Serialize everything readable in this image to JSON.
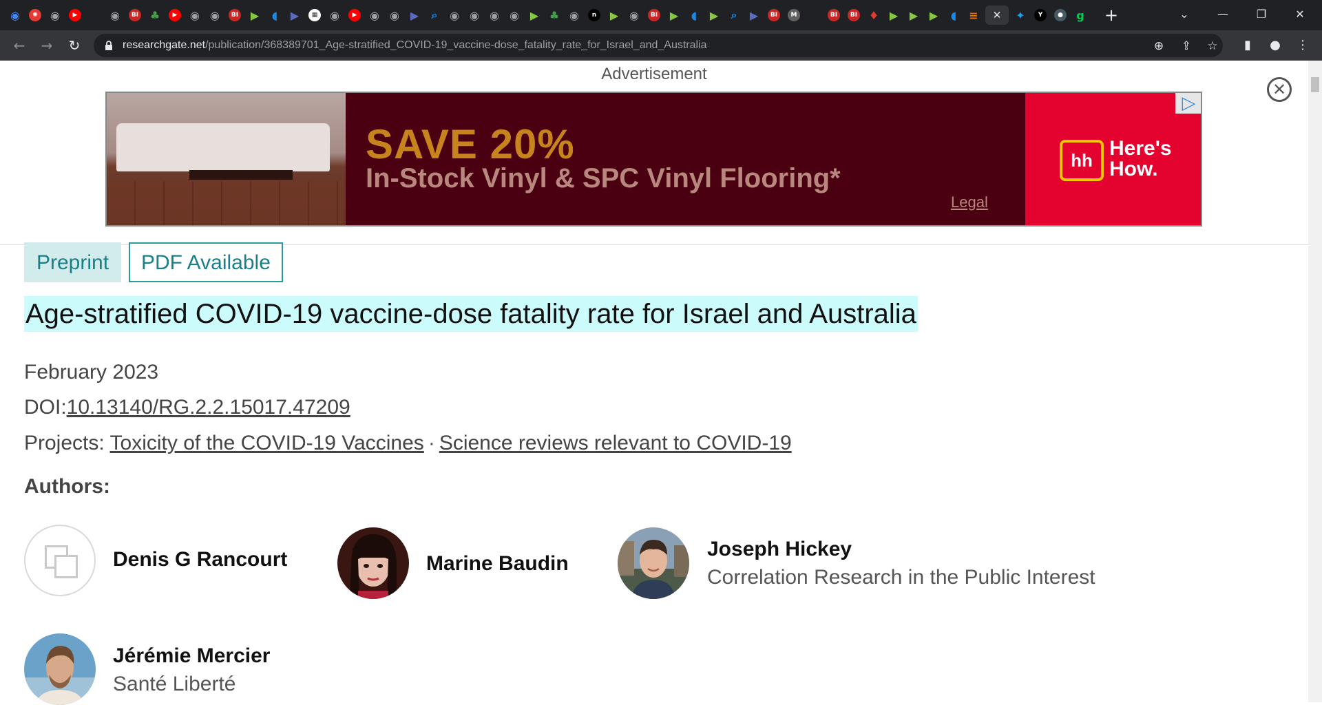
{
  "browser": {
    "url_host": "researchgate.net",
    "url_path": "/publication/368389701_Age-stratified_COVID-19_vaccine-dose_fatality_rate_for_Israel_and_Australia",
    "new_tab_label": "+",
    "tabs": [
      {
        "icon": "globe-icon",
        "color": "#4285f4",
        "glyph": "◉"
      },
      {
        "icon": "soccer-icon",
        "color": "#e53935",
        "glyph": "✺"
      },
      {
        "icon": "globe-icon",
        "color": "#9aa0a6",
        "glyph": "◉"
      },
      {
        "icon": "youtube-icon",
        "color": "#ff0000",
        "glyph": "▶"
      },
      {
        "icon": "blank-icon",
        "color": "#202124",
        "glyph": ""
      },
      {
        "icon": "globe-icon",
        "color": "#9aa0a6",
        "glyph": "◉"
      },
      {
        "icon": "bi-icon",
        "color": "#c62828",
        "glyph": "BI"
      },
      {
        "icon": "tree-icon",
        "color": "#43a047",
        "glyph": "♣"
      },
      {
        "icon": "youtube-icon",
        "color": "#ff0000",
        "glyph": "▶"
      },
      {
        "icon": "globe-icon",
        "color": "#9aa0a6",
        "glyph": "◉"
      },
      {
        "icon": "globe-icon",
        "color": "#9aa0a6",
        "glyph": "◉"
      },
      {
        "icon": "bi-icon",
        "color": "#c62828",
        "glyph": "BI"
      },
      {
        "icon": "rumble-icon",
        "color": "#85c742",
        "glyph": "▶"
      },
      {
        "icon": "shield-icon",
        "color": "#1e88e5",
        "glyph": "◖"
      },
      {
        "icon": "flag-icon",
        "color": "#5c6bc0",
        "glyph": "▶"
      },
      {
        "icon": "qr-icon",
        "color": "#ffffff",
        "glyph": "▦"
      },
      {
        "icon": "globe-icon",
        "color": "#9aa0a6",
        "glyph": "◉"
      },
      {
        "icon": "youtube-icon",
        "color": "#ff0000",
        "glyph": "▶"
      },
      {
        "icon": "globe-icon",
        "color": "#9aa0a6",
        "glyph": "◉"
      },
      {
        "icon": "globe-icon",
        "color": "#9aa0a6",
        "glyph": "◉"
      },
      {
        "icon": "flag-icon",
        "color": "#5c6bc0",
        "glyph": "▶"
      },
      {
        "icon": "search-icon",
        "color": "#1e88e5",
        "glyph": "⌕"
      },
      {
        "icon": "globe-icon",
        "color": "#9aa0a6",
        "glyph": "◉"
      },
      {
        "icon": "globe-icon",
        "color": "#9aa0a6",
        "glyph": "◉"
      },
      {
        "icon": "globe-icon",
        "color": "#9aa0a6",
        "glyph": "◉"
      },
      {
        "icon": "globe-icon",
        "color": "#9aa0a6",
        "glyph": "◉"
      },
      {
        "icon": "rumble-icon",
        "color": "#85c742",
        "glyph": "▶"
      },
      {
        "icon": "tree-icon",
        "color": "#43a047",
        "glyph": "♣"
      },
      {
        "icon": "globe-icon",
        "color": "#9aa0a6",
        "glyph": "◉"
      },
      {
        "icon": "n-icon",
        "color": "#000000",
        "glyph": "n"
      },
      {
        "icon": "rumble-icon",
        "color": "#85c742",
        "glyph": "▶"
      },
      {
        "icon": "globe-icon",
        "color": "#9aa0a6",
        "glyph": "◉"
      },
      {
        "icon": "bi-icon",
        "color": "#c62828",
        "glyph": "BI"
      },
      {
        "icon": "rumble-icon",
        "color": "#85c742",
        "glyph": "▶"
      },
      {
        "icon": "shield-icon",
        "color": "#1e88e5",
        "glyph": "◖"
      },
      {
        "icon": "rumble-icon",
        "color": "#85c742",
        "glyph": "▶"
      },
      {
        "icon": "search-icon",
        "color": "#1e88e5",
        "glyph": "⌕"
      },
      {
        "icon": "flag-icon",
        "color": "#5c6bc0",
        "glyph": "▶"
      },
      {
        "icon": "bi-icon",
        "color": "#c62828",
        "glyph": "BI"
      },
      {
        "icon": "italic-icon",
        "color": "#616161",
        "glyph": "M"
      },
      {
        "icon": "blank-icon",
        "color": "#202124",
        "glyph": ""
      },
      {
        "icon": "bi-icon",
        "color": "#c62828",
        "glyph": "BI"
      },
      {
        "icon": "bi-icon",
        "color": "#c62828",
        "glyph": "BI"
      },
      {
        "icon": "pin-icon",
        "color": "#e53935",
        "glyph": "♦"
      },
      {
        "icon": "rumble-icon",
        "color": "#85c742",
        "glyph": "▶"
      },
      {
        "icon": "rumble-icon",
        "color": "#85c742",
        "glyph": "▶"
      },
      {
        "icon": "rumble-icon",
        "color": "#85c742",
        "glyph": "▶"
      },
      {
        "icon": "shield-icon",
        "color": "#1e88e5",
        "glyph": "◖"
      },
      {
        "icon": "bookmark-icon",
        "color": "#ef6c00",
        "glyph": "≡"
      }
    ],
    "active_tab": {
      "icon": "close-icon",
      "glyph": "✕"
    },
    "tabs_after": [
      {
        "icon": "twitter-icon",
        "color": "#1da1f2",
        "glyph": "✦"
      },
      {
        "icon": "y-icon",
        "color": "#000000",
        "glyph": "Y"
      },
      {
        "icon": "drop-icon",
        "color": "#455a64",
        "glyph": "●"
      },
      {
        "icon": "g-icon",
        "color": "#00c853",
        "glyph": "g"
      }
    ]
  },
  "ad": {
    "label": "Advertisement",
    "headline": "SAVE 20%",
    "subline": "In-Stock Vinyl & SPC Vinyl Flooring*",
    "legal": "Legal",
    "brand_line1": "Here's",
    "brand_line2": "How.",
    "brand_mark": "hh"
  },
  "publication": {
    "badge_preprint": "Preprint",
    "badge_pdf": "PDF Available",
    "title": "Age-stratified COVID-19 vaccine-dose fatality rate for Israel and Australia",
    "date": "February 2023",
    "doi_label": "DOI:",
    "doi": "10.13140/RG.2.2.15017.47209",
    "projects_label": "Projects:",
    "projects": [
      "Toxicity of the COVID-19 Vaccines",
      "Science reviews relevant to COVID-19"
    ],
    "project_separator": "·",
    "authors_label": "Authors:",
    "authors": [
      {
        "name": "Denis G Rancourt",
        "affiliation": ""
      },
      {
        "name": "Marine Baudin",
        "affiliation": ""
      },
      {
        "name": "Joseph Hickey",
        "affiliation": "Correlation Research in the Public Interest"
      },
      {
        "name": "Jérémie Mercier",
        "affiliation": "Santé Liberté"
      }
    ]
  }
}
